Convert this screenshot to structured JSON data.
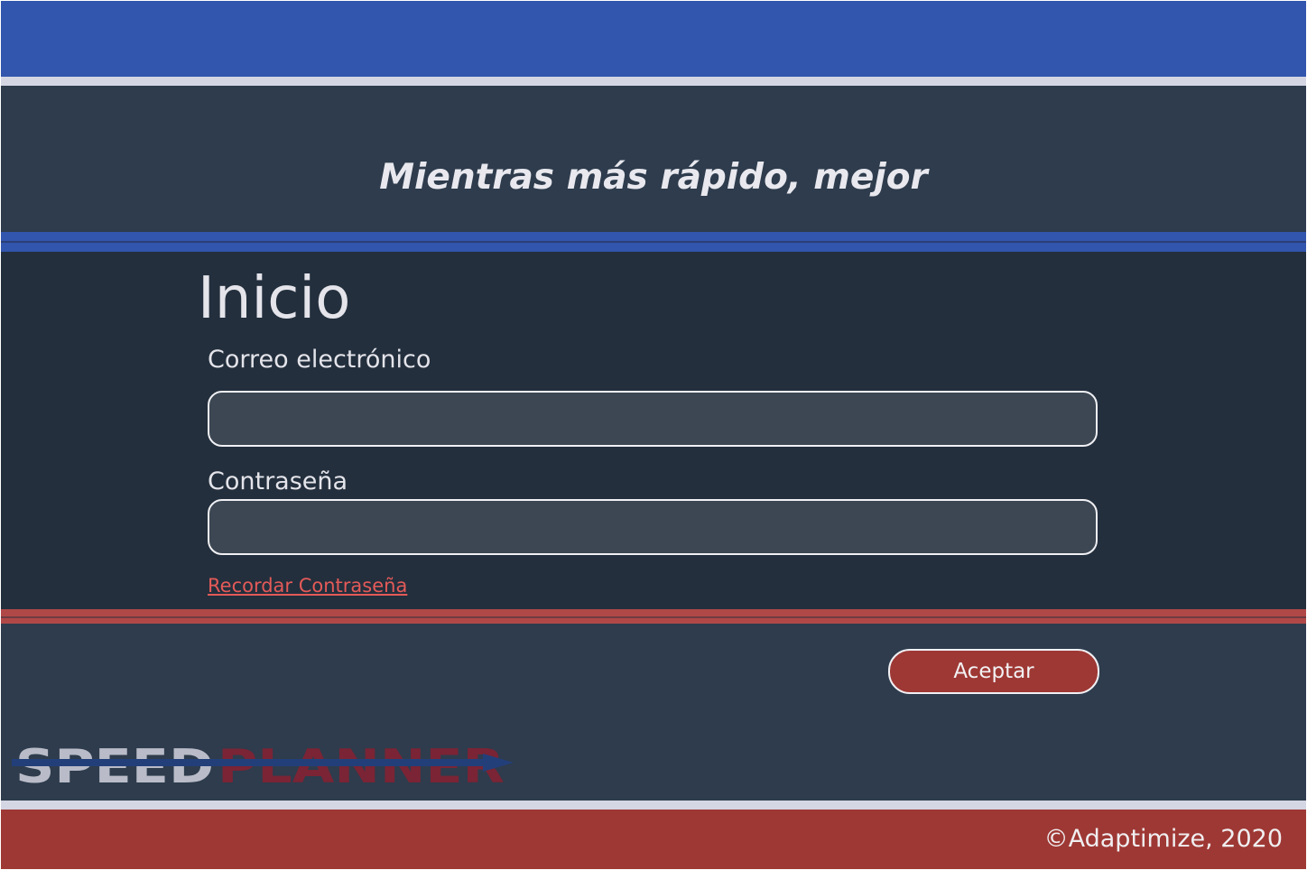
{
  "header": {
    "tagline": "Mientras más rápido, mejor"
  },
  "login": {
    "title": "Inicio",
    "email_label": "Correo electrónico",
    "email_value": "",
    "password_label": "Contraseña",
    "password_value": "",
    "forgot_password_link": "Recordar Contraseña",
    "accept_button": "Aceptar"
  },
  "logo": {
    "part1": "SPEED",
    "part2": "PLANNER",
    "part1_color": "#b9bcc8",
    "part2_color": "#7a2435",
    "arrow_color": "#233f7a"
  },
  "footer": {
    "copyright": "©Adaptimize, 2020"
  },
  "colors": {
    "primary_blue": "#3255ad",
    "dark_panel": "#2e3c4d",
    "darker_panel": "#232f3d",
    "accent_red": "#9e3834",
    "link_red": "#e45a58"
  }
}
